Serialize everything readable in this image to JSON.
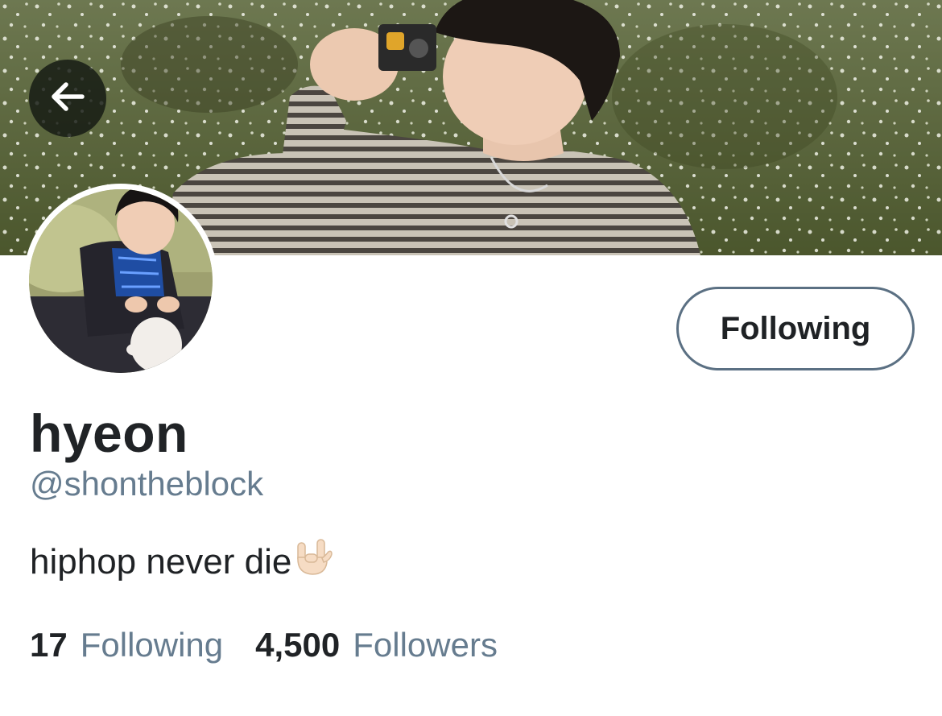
{
  "profile": {
    "display_name": "hyeon",
    "handle": "@shontheblock",
    "bio": "hiphop never die",
    "bio_emoji": "hand-sign-i-love-you-icon"
  },
  "actions": {
    "follow_label": "Following"
  },
  "stats": {
    "following_count": "17",
    "following_label": "Following",
    "followers_count": "4,500",
    "followers_label": "Followers"
  },
  "colors": {
    "primary_text": "#202326",
    "secondary_text": "#667c8f",
    "button_border": "#5b7083",
    "background": "#ffffff"
  },
  "icons": {
    "back": "arrow-left-icon"
  }
}
